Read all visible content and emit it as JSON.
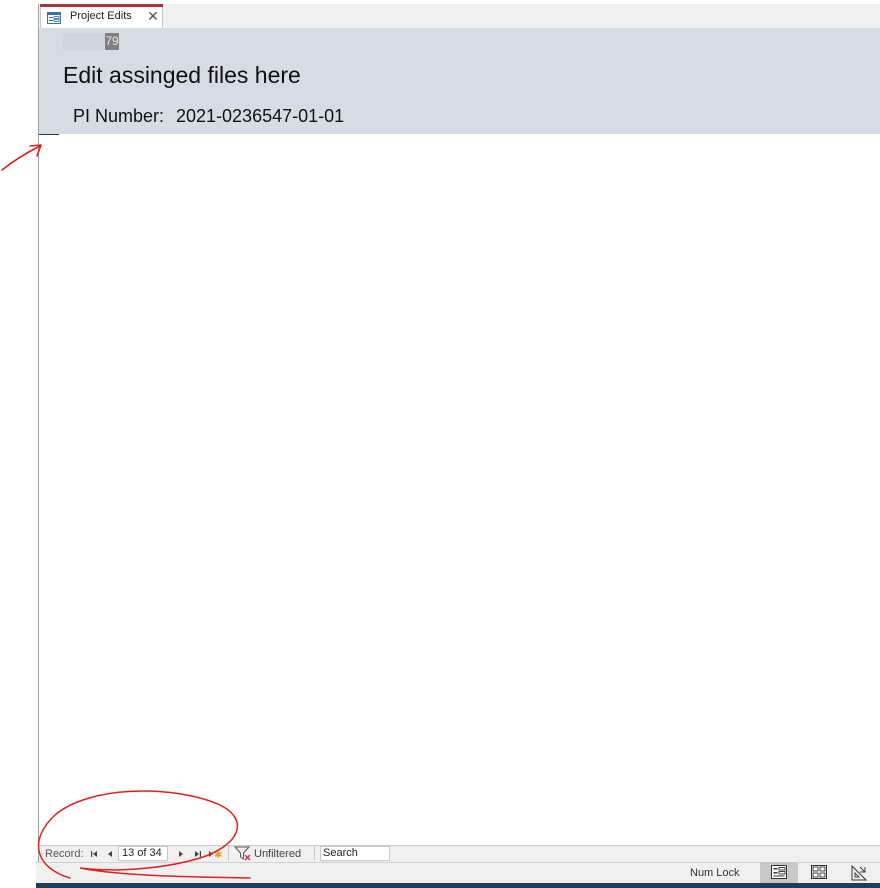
{
  "tab": {
    "label": "Project Edits",
    "close_glyph": "✕",
    "icon": "form-icon"
  },
  "header": {
    "id_value": "79",
    "title": "Edit assinged files here",
    "pi_label": "PI Number:",
    "pi_value": "2021-0236547-01-01"
  },
  "navigator": {
    "record_label": "Record:",
    "position": "13 of 34",
    "filter_label": "Unfiltered",
    "search_placeholder": "Search",
    "icons": [
      "first-record-icon",
      "previous-record-icon",
      "next-record-icon",
      "last-record-icon",
      "new-record-icon",
      "filter-icon"
    ]
  },
  "status_bar": {
    "num_lock": "Num Lock",
    "views": [
      "form-view-icon",
      "layout-view-icon",
      "design-view-icon"
    ]
  },
  "colors": {
    "header_bg": "#d6dce4",
    "tab_accent": "#a4373a",
    "annotation": "#e0201a",
    "status_bar": "#f0f0f0"
  }
}
